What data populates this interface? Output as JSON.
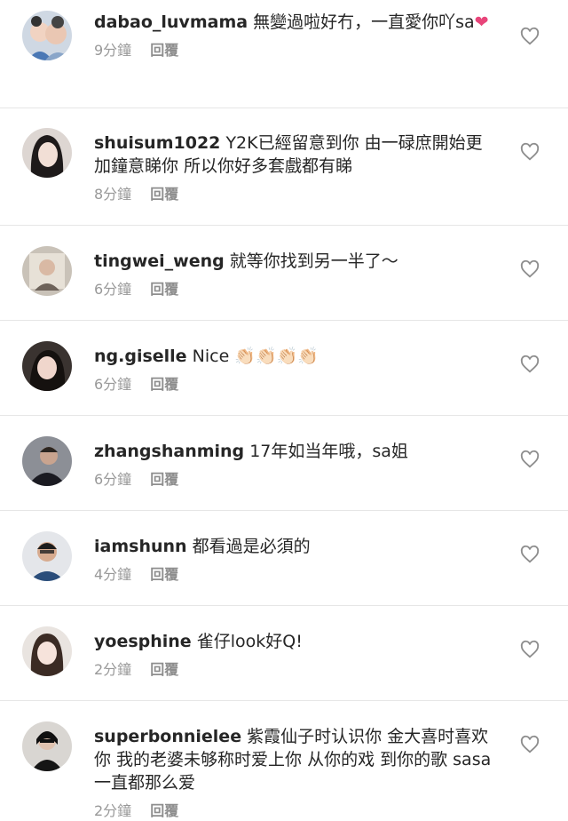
{
  "comments": [
    {
      "username": "dabao_luvmama",
      "text": "無變過啦好冇，一直愛你吖sa",
      "emoji": "❤",
      "time": "9分鐘",
      "reply": "回覆"
    },
    {
      "username": "shuisum1022",
      "text": "Y2K已經留意到你 由一碌庶開始更加鐘意睇你 所以你好多套戲都有睇",
      "time": "8分鐘",
      "reply": "回覆"
    },
    {
      "username": "tingwei_weng",
      "text": "就等你找到另一半了～",
      "time": "6分鐘",
      "reply": "回覆"
    },
    {
      "username": "ng.giselle",
      "text": "Nice 👏🏻👏🏻👏🏻👏🏻",
      "time": "6分鐘",
      "reply": "回覆"
    },
    {
      "username": "zhangshanming",
      "text": "17年如当年哦，sa姐",
      "time": "6分鐘",
      "reply": "回覆"
    },
    {
      "username": "iamshunn",
      "text": "都看過是必須的",
      "time": "4分鐘",
      "reply": "回覆"
    },
    {
      "username": "yoesphine",
      "text": "雀仔look好Q!",
      "time": "2分鐘",
      "reply": "回覆"
    },
    {
      "username": "superbonnielee",
      "text": "紫霞仙子时认识你 金大喜时喜欢你 我的老婆未够称时爱上你 从你的戏 到你的歌 sasa一直都那么爱",
      "time": "2分鐘",
      "reply": "回覆"
    }
  ],
  "colors": {
    "username": "#262626",
    "meta": "#999999",
    "divider": "#e6e6e6",
    "heart_outline": "#8e8e8e",
    "emoji_heart": "#e8457a"
  },
  "icons": {
    "like": "heart-outline-icon"
  }
}
